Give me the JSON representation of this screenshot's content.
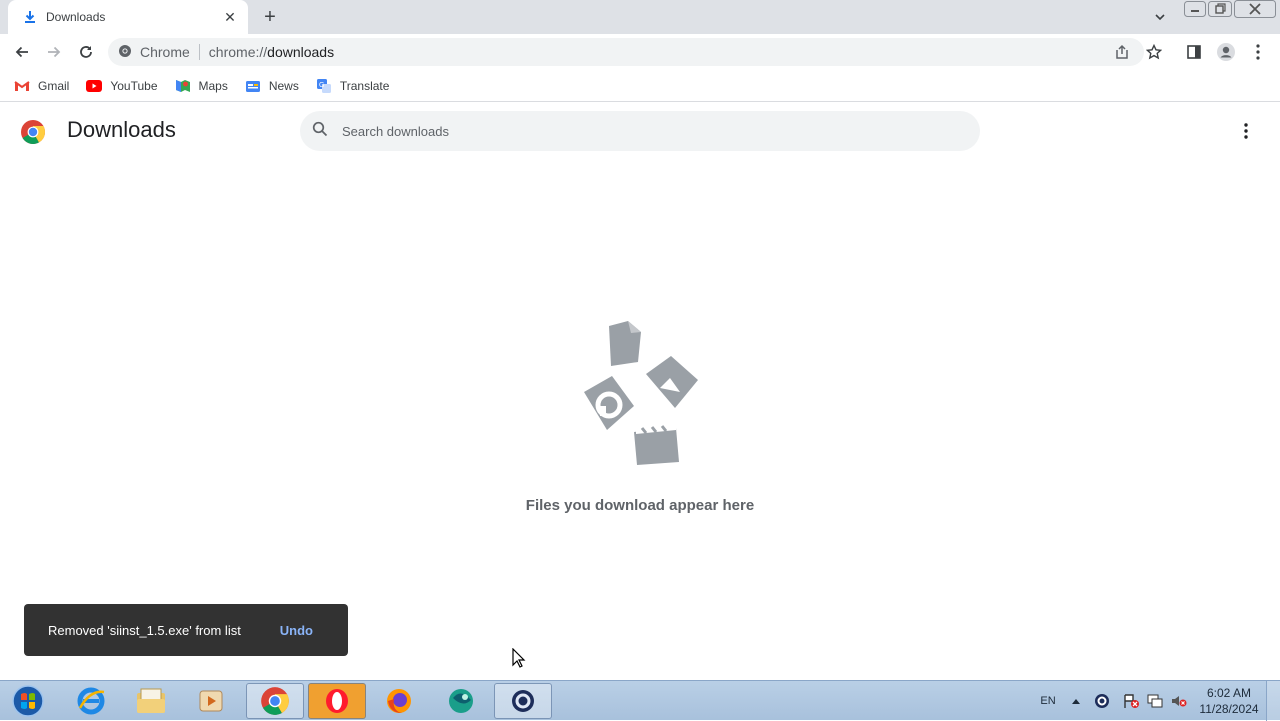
{
  "tab": {
    "title": "Downloads",
    "close": "✕",
    "new_tab": "+"
  },
  "window_controls": {
    "minimize": "—",
    "restore": "❐",
    "close": "✕"
  },
  "omnibox": {
    "site_label": "Chrome",
    "url_scheme": "chrome://",
    "url_host": "downloads"
  },
  "bookmarks": [
    {
      "label": "Gmail",
      "icon": "gmail-icon"
    },
    {
      "label": "YouTube",
      "icon": "youtube-icon"
    },
    {
      "label": "Maps",
      "icon": "maps-icon"
    },
    {
      "label": "News",
      "icon": "news-icon"
    },
    {
      "label": "Translate",
      "icon": "translate-icon"
    }
  ],
  "page": {
    "title": "Downloads",
    "search_placeholder": "Search downloads",
    "empty_message": "Files you download appear here"
  },
  "toast": {
    "message": "Removed 'siinst_1.5.exe' from list",
    "action": "Undo"
  },
  "taskbar": {
    "items": [
      "start",
      "internet-explorer",
      "file-explorer",
      "media-player",
      "chrome",
      "opera",
      "firefox",
      "app-green",
      "app-search"
    ],
    "lang": "EN",
    "time": "6:02 AM",
    "date": "11/28/2024"
  },
  "colors": {
    "accent": "#1a73e8",
    "toast_bg": "#323232",
    "undo": "#8ab4f8",
    "taskbar": "#b9cfe6"
  }
}
